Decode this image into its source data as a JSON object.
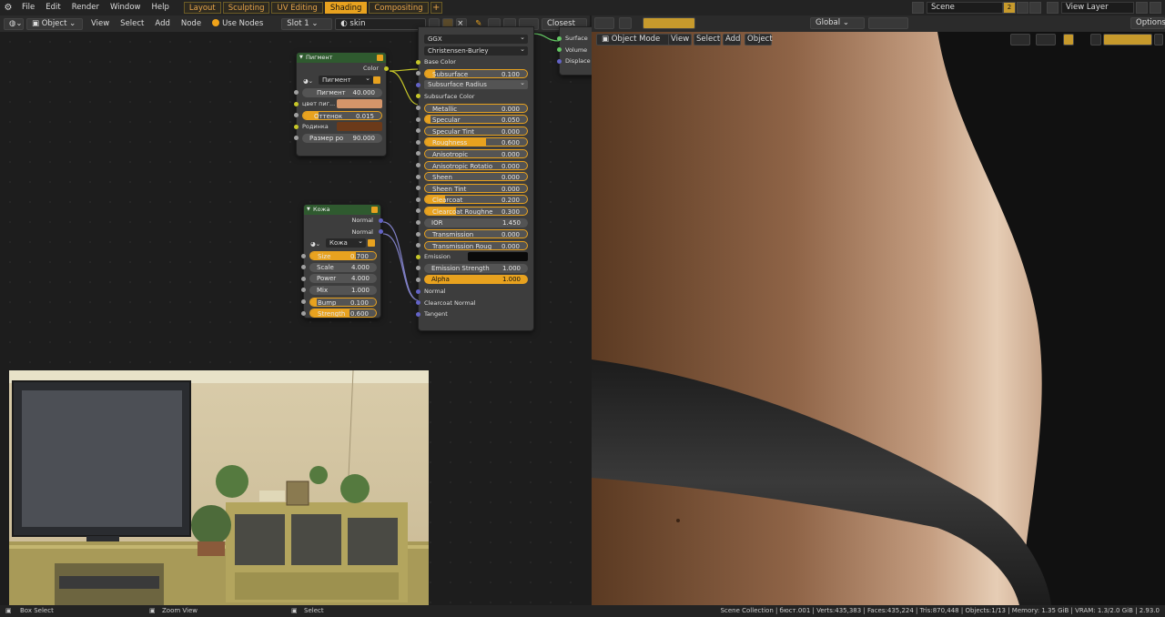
{
  "menu": [
    "File",
    "Edit",
    "Render",
    "Window",
    "Help"
  ],
  "workspaces": [
    {
      "label": "Layout",
      "active": false
    },
    {
      "label": "Sculpting",
      "active": false
    },
    {
      "label": "UV Editing",
      "active": false
    },
    {
      "label": "Shading",
      "active": true
    },
    {
      "label": "Compositing",
      "active": false
    }
  ],
  "scene": "Scene",
  "scene_count": "2",
  "view_layer": "View Layer",
  "node_header": {
    "mode": "Object",
    "view": "View",
    "select": "Select",
    "add": "Add",
    "node": "Node",
    "use_nodes": "Use Nodes",
    "slot": "Slot 1",
    "material": "skin",
    "interpolation": "Closest"
  },
  "viewport_header": {
    "global": "Global",
    "options": "Options",
    "mode": "Object Mode",
    "view": "View",
    "select": "Select",
    "add": "Add",
    "object": "Object"
  },
  "pigment_node": {
    "title": "Пигмент",
    "output": "Color",
    "group": "Пигмент",
    "fields": [
      {
        "label": "Пигмент",
        "value": "40.000"
      },
      {
        "label": "цвет пиг...",
        "value": ""
      },
      {
        "label": "Оттенок",
        "value": "0.015"
      },
      {
        "label": "Родинка",
        "value": ""
      },
      {
        "label": "Размер ро",
        "value": "90.000"
      }
    ],
    "colors": {
      "pigment_color": "#d4956a",
      "mole_color": "#6b3a1a"
    }
  },
  "skin_node": {
    "title": "Кожа",
    "outputs": [
      "Normal",
      "Normal"
    ],
    "group": "Кожа",
    "fields": [
      {
        "label": "Size",
        "value": "0.700"
      },
      {
        "label": "Scale",
        "value": "4.000"
      },
      {
        "label": "Power",
        "value": "4.000"
      },
      {
        "label": "Mix",
        "value": "1.000"
      },
      {
        "label": "Bump",
        "value": "0.100"
      },
      {
        "label": "Strength",
        "value": "0.600"
      }
    ]
  },
  "bsdf_node": {
    "distribution": "GGX",
    "subsurface_method": "Christensen-Burley",
    "base_color": "Base Color",
    "subsurface_radius": "Subsurface Radius",
    "subsurface_color": "Subsurface Color",
    "fields": [
      {
        "label": "Subsurface",
        "value": "0.100"
      },
      {
        "label": "Metallic",
        "value": "0.000"
      },
      {
        "label": "Specular",
        "value": "0.050"
      },
      {
        "label": "Specular Tint",
        "value": "0.000"
      },
      {
        "label": "Roughness",
        "value": "0.600"
      },
      {
        "label": "Anisotropic",
        "value": "0.000"
      },
      {
        "label": "Anisotropic Rotatio",
        "value": "0.000"
      },
      {
        "label": "Sheen",
        "value": "0.000"
      },
      {
        "label": "Sheen Tint",
        "value": "0.000"
      },
      {
        "label": "Clearcoat",
        "value": "0.200"
      },
      {
        "label": "Clearcoat Roughne",
        "value": "0.300"
      },
      {
        "label": "IOR",
        "value": "1.450"
      },
      {
        "label": "Transmission",
        "value": "0.000"
      },
      {
        "label": "Transmission Roug",
        "value": "0.000"
      },
      {
        "label": "Emission Strength",
        "value": "1.000"
      },
      {
        "label": "Alpha",
        "value": "1.000"
      }
    ],
    "emission": "Emission",
    "normal": "Normal",
    "clearcoat_normal": "Clearcoat Normal",
    "tangent": "Tangent"
  },
  "output_node": {
    "sockets": [
      "Surface",
      "Volume",
      "Displace"
    ]
  },
  "status": {
    "box_select": "Box Select",
    "zoom_view": "Zoom View",
    "select": "Select",
    "info": "Scene Collection | бюст.001 | Verts:435,383 | Faces:435,224 | Tris:870,448 | Objects:1/13 | Memory: 1.35 GiB | VRAM: 1.3/2.0 GiB | 2.93.0"
  }
}
